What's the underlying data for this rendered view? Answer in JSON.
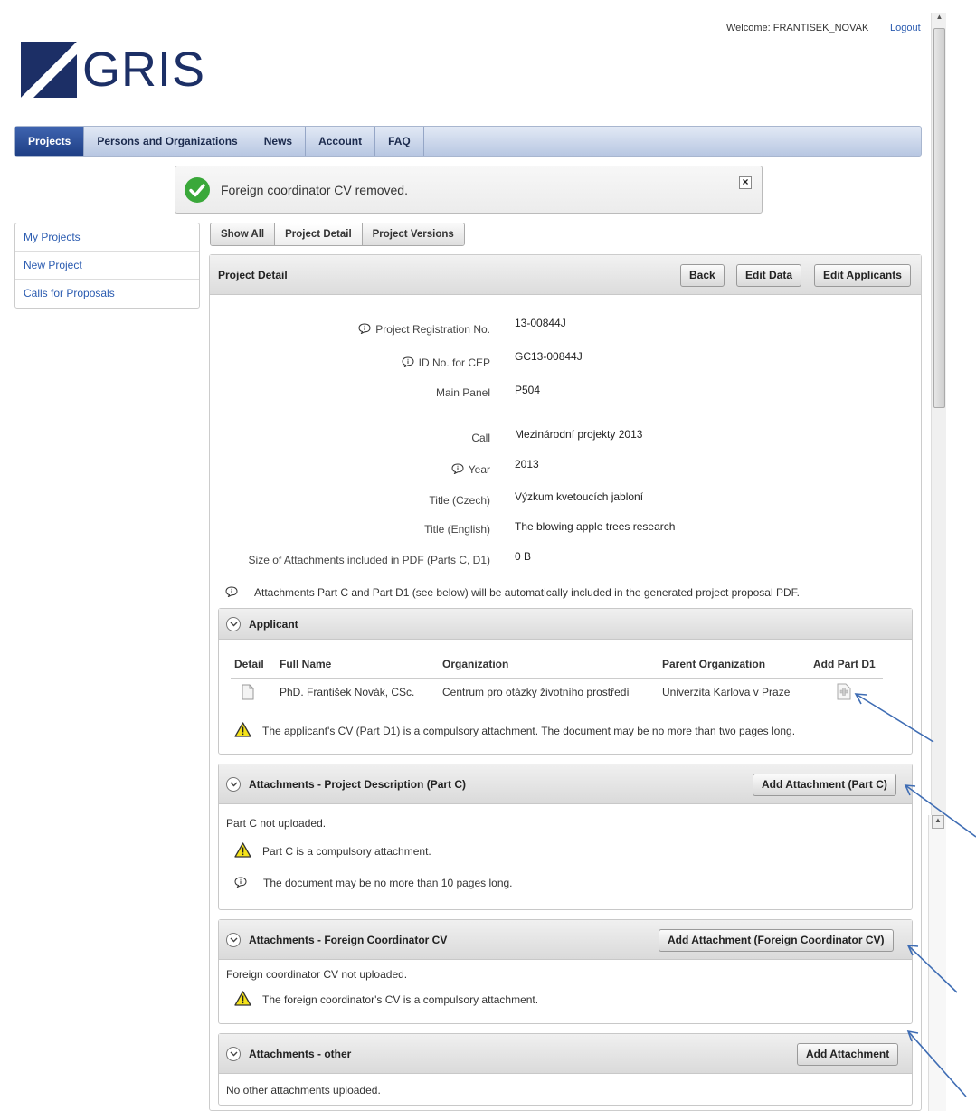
{
  "header": {
    "welcome": "Welcome: FRANTISEK_NOVAK",
    "logout": "Logout",
    "logo_text": "GRIS"
  },
  "nav": {
    "items": [
      "Projects",
      "Persons and Organizations",
      "News",
      "Account",
      "FAQ"
    ],
    "active": "Projects"
  },
  "notification": {
    "message": "Foreign coordinator CV removed."
  },
  "sidebar": {
    "items": [
      "My Projects",
      "New Project",
      "Calls for Proposals"
    ]
  },
  "tabs": {
    "items": [
      "Show All",
      "Project Detail",
      "Project Versions"
    ],
    "active": "Project Detail"
  },
  "project": {
    "panel_title": "Project Detail",
    "buttons": {
      "back": "Back",
      "edit_data": "Edit Data",
      "edit_applicants": "Edit Applicants"
    },
    "fields": {
      "reg_no_label": "Project Registration No.",
      "reg_no": "13-00844J",
      "cep_label": "ID No. for CEP",
      "cep": "GC13-00844J",
      "panel_label": "Main Panel",
      "panel": "P504",
      "call_label": "Call",
      "call": "Mezinárodní projekty 2013",
      "year_label": "Year",
      "year": "2013",
      "title_cz_label": "Title (Czech)",
      "title_cz": "Výzkum kvetoucích jabloní",
      "title_en_label": "Title (English)",
      "title_en": "The blowing apple trees research",
      "size_label": "Size of Attachments included in PDF (Parts C, D1)",
      "size": "0 B"
    },
    "note": "Attachments Part C and Part D1 (see below) will be automatically included in the generated project proposal PDF."
  },
  "applicant": {
    "title": "Applicant",
    "columns": {
      "detail": "Detail",
      "full_name": "Full Name",
      "organization": "Organization",
      "parent": "Parent Organization",
      "add_d1": "Add Part D1"
    },
    "row": {
      "full_name": "PhD. František Novák, CSc.",
      "organization": "Centrum pro otázky životního prostředí",
      "parent": "Univerzita Karlova v Praze"
    },
    "warning": "The applicant's CV (Part D1) is a compulsory attachment. The document may be no more than two pages long."
  },
  "part_c": {
    "title": "Attachments - Project Description (Part C)",
    "button": "Add Attachment (Part C)",
    "status": "Part C not uploaded.",
    "warning": "Part C is a compulsory attachment.",
    "info": "The document may be no more than 10 pages long."
  },
  "foreign_cv": {
    "title": "Attachments - Foreign Coordinator CV",
    "button": "Add Attachment (Foreign Coordinator CV)",
    "status": "Foreign coordinator CV not uploaded.",
    "warning": "The foreign coordinator's CV is a compulsory attachment."
  },
  "other": {
    "title": "Attachments - other",
    "button": "Add Attachment",
    "status": "No other attachments uploaded."
  },
  "colors": {
    "nav_active": "#2b4d97",
    "link": "#2a5bb0",
    "logo": "#1c2f66",
    "success": "#3aa83a",
    "warning": "#f5e31a",
    "annotation_arrow": "#3f6db4"
  }
}
